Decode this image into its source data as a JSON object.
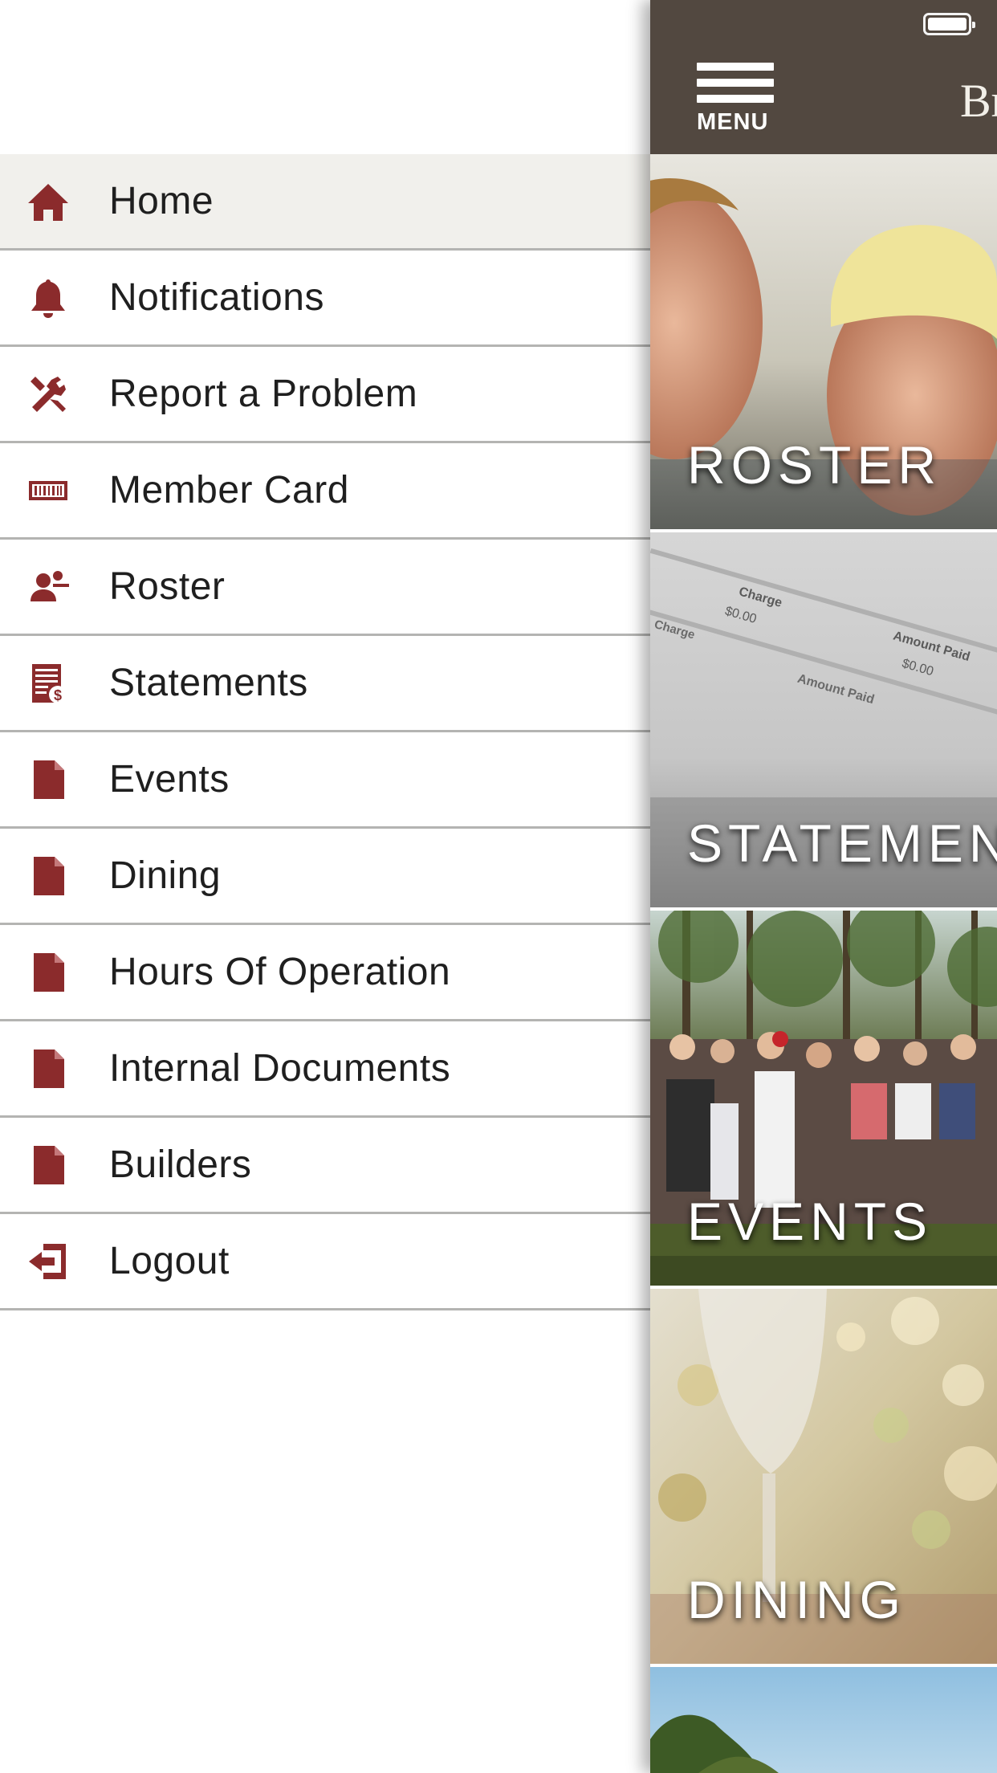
{
  "drawer": {
    "items": [
      {
        "label": "Home",
        "icon": "home-icon",
        "active": true
      },
      {
        "label": "Notifications",
        "icon": "bell-icon"
      },
      {
        "label": "Report a Problem",
        "icon": "tools-icon"
      },
      {
        "label": "Member Card",
        "icon": "barcode-card-icon"
      },
      {
        "label": "Roster",
        "icon": "person-roster-icon"
      },
      {
        "label": "Statements",
        "icon": "statement-icon"
      },
      {
        "label": "Events",
        "icon": "document-icon"
      },
      {
        "label": "Dining",
        "icon": "document-icon"
      },
      {
        "label": "Hours Of Operation",
        "icon": "document-icon"
      },
      {
        "label": "Internal Documents",
        "icon": "document-icon"
      },
      {
        "label": "Builders",
        "icon": "document-icon"
      },
      {
        "label": "Logout",
        "icon": "logout-icon"
      }
    ]
  },
  "topbar": {
    "menu_label": "MENU",
    "brand_text": "Br"
  },
  "tiles": [
    {
      "caption": "ROSTER"
    },
    {
      "caption": "STATEMENTS"
    },
    {
      "caption": "EVENTS"
    },
    {
      "caption": "DINING"
    }
  ],
  "statement_photo": {
    "col_charge": "Charge",
    "col_amount_paid": "Amount Paid",
    "val_charge": "$0.00",
    "val_amount": "$0.00"
  },
  "colors": {
    "accent": "#8b2b2c",
    "topbar": "#524840",
    "active_row": "#f1f0ec",
    "divider": "#b4b4b2"
  }
}
